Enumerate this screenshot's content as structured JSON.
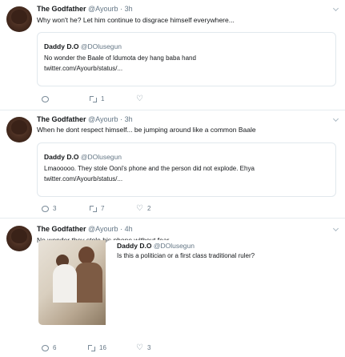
{
  "tweets": [
    {
      "name": "The Godfather",
      "handle": "@Ayourb",
      "sep": "·",
      "time": "3h",
      "text": "Why won't he? Let him continue to disgrace himself everywhere...",
      "quote": {
        "name": "Daddy D.O",
        "handle": "@DOlusegun",
        "lines": [
          "No wonder the Baale of Idumota dey hang baba hand",
          "twitter.com/Ayourb/status/..."
        ]
      },
      "replies": "",
      "retweets": "1",
      "likes": ""
    },
    {
      "name": "The Godfather",
      "handle": "@Ayourb",
      "sep": "·",
      "time": "3h",
      "text": "When he dont respect himself... be jumping around like a common Baale",
      "quote": {
        "name": "Daddy D.O",
        "handle": "@DOlusegun",
        "lines": [
          "Lmaooooo. They stole Ooni's phone and the person did not explode. Ehya",
          "twitter.com/Ayourb/status/..."
        ]
      },
      "replies": "3",
      "retweets": "7",
      "likes": "2"
    },
    {
      "name": "The Godfather",
      "handle": "@Ayourb",
      "sep": "·",
      "time": "4h",
      "text": "No wonder they stole his phone without fear...",
      "quote": {
        "name": "Daddy D.O",
        "handle": "@DOlusegun",
        "lines": [
          "Is this a politician or a first class traditional ruler?"
        ]
      },
      "replies": "6",
      "retweets": "16",
      "likes": "3"
    }
  ],
  "icons": {
    "reply": "reply-icon",
    "retweet": "retweet-icon",
    "like": "heart-icon",
    "more": "chevron-down-icon"
  },
  "colors": {
    "text": "#14171a",
    "muted": "#657786",
    "border": "#e1e8ed"
  }
}
